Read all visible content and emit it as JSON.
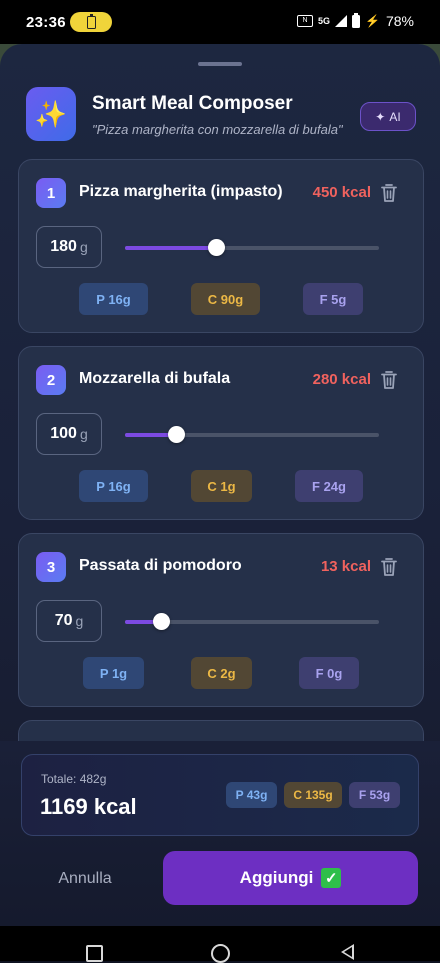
{
  "status_bar": {
    "time": "23:36",
    "network": "5G",
    "battery_percent": "78%"
  },
  "header": {
    "title": "Smart Meal Composer",
    "subtitle": "\"Pizza margherita con mozzarella di bufala\"",
    "ai_badge": "AI"
  },
  "items": [
    {
      "number": "1",
      "name": "Pizza margherita (impasto)",
      "kcal": "450 kcal",
      "grams": "180",
      "unit": "g",
      "slider_fraction": 0.36,
      "protein": "P  16g",
      "carbs": "C  90g",
      "fat": "F  5g"
    },
    {
      "number": "2",
      "name": "Mozzarella di bufala",
      "kcal": "280 kcal",
      "grams": "100",
      "unit": "g",
      "slider_fraction": 0.2,
      "protein": "P  16g",
      "carbs": "C  1g",
      "fat": "F  24g"
    },
    {
      "number": "3",
      "name": "Passata di pomodoro",
      "kcal": "13 kcal",
      "grams": "70",
      "unit": "g",
      "slider_fraction": 0.14,
      "protein": "P  1g",
      "carbs": "C  2g",
      "fat": "F  0g"
    }
  ],
  "summary": {
    "total_weight": "Totale: 482g",
    "total_kcal": "1169 kcal",
    "protein": "P 43g",
    "carbs": "C 135g",
    "fat": "F 53g"
  },
  "actions": {
    "cancel_label": "Annulla",
    "add_label": "Aggiungi"
  },
  "colors": {
    "accent": "#6d2fc2",
    "kcal": "#f0625e",
    "protein": "#7fb2f4",
    "carbs": "#ecb845",
    "fat": "#a9a2ef"
  }
}
